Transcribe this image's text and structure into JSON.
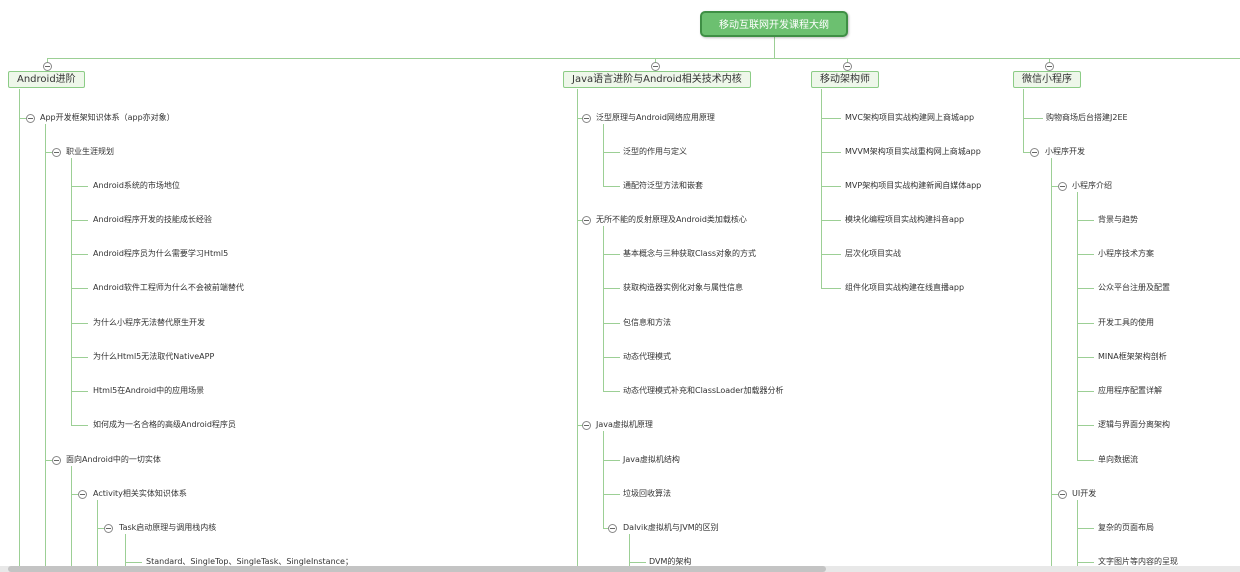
{
  "root": "移动互联网开发课程大纲",
  "branches": {
    "android": "Android进阶",
    "java": "Java语言进阶与Android相关技术内核",
    "arch": "移动架构师",
    "wechat": "微信小程序"
  },
  "android": {
    "l1": "App开发框架知识体系（app亦对象）",
    "career": "职业生涯规划",
    "career_items": [
      "Android系统的市场地位",
      "Android程序开发的技能成长经验",
      "Android程序员为什么需要学习Html5",
      "Android软件工程师为什么不会被前端替代",
      "为什么小程序无法替代原生开发",
      "为什么Html5无法取代NativeAPP",
      "Html5在Android中的应用场景",
      "如何成为一名合格的高级Android程序员"
    ],
    "entity": "面向Android中的一切实体",
    "activity": "Activity相关实体知识体系",
    "task": "Task启动原理与调用栈内核",
    "launch_modes": "Standard、SingleTop、SingleTask、SingleInstance；"
  },
  "java": {
    "generics": "泛型原理与Android网络应用原理",
    "generics_items": [
      "泛型的作用与定义",
      "通配符泛型方法和嵌套"
    ],
    "reflection": "无所不能的反射原理及Android类加载核心",
    "reflection_items": [
      "基本概念与三种获取Class对象的方式",
      "获取构造器实例化对象与属性信息",
      "包信息和方法",
      "动态代理模式",
      "动态代理模式补充和ClassLoader加载器分析"
    ],
    "jvm": "Java虚拟机原理",
    "jvm_items": [
      "Java虚拟机结构",
      "垃圾回收算法",
      "Dalvik虚拟机与JVM的区别"
    ],
    "dvm": "DVM的架构"
  },
  "arch": {
    "items": [
      "MVC架构项目实战构建网上商城app",
      "MVVM架构项目实战重构网上商城app",
      "MVP架构项目实战构建新闻自媒体app",
      "模块化编程项目实战构建抖音app",
      "层次化项目实战",
      "组件化项目实战构建在线直播app"
    ]
  },
  "wechat": {
    "l1a": "购物商场后台搭建J2EE",
    "dev": "小程序开发",
    "intro": "小程序介绍",
    "intro_items": [
      "背景与趋势",
      "小程序技术方案",
      "公众平台注册及配置",
      "开发工具的使用",
      "MINA框架架构剖析",
      "应用程序配置详解",
      "逻辑与界面分离架构",
      "单向数据流"
    ],
    "ui": "UI开发",
    "ui_items": [
      "复杂的页面布局",
      "文字图片等内容的呈现"
    ]
  }
}
